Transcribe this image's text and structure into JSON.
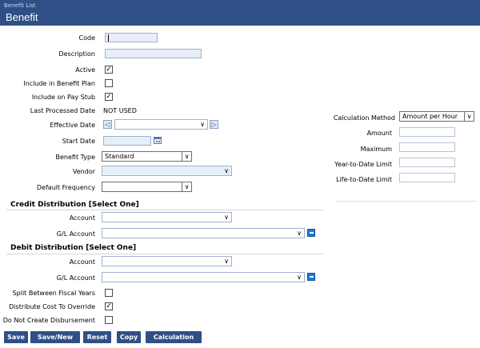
{
  "header": {
    "crumb": "Benefit List",
    "title": "Benefit"
  },
  "fields": {
    "code": "Code",
    "description": "Description",
    "active": "Active",
    "include_in_benefit_plan": "Include in Benefit Plan",
    "include_on_pay_stub": "Include on Pay Stub",
    "last_processed_date": "Last Processed Date",
    "last_processed_value": "NOT USED",
    "effective_date": "Effective Date",
    "start_date": "Start Date",
    "benefit_type": "Benefit Type",
    "benefit_type_value": "Standard",
    "vendor": "Vendor",
    "default_frequency": "Default Frequency"
  },
  "credit": {
    "title": "Credit Distribution [Select One]",
    "account": "Account",
    "gl_account": "G/L Account"
  },
  "debit": {
    "title": "Debit Distribution [Select One]",
    "account": "Account",
    "gl_account": "G/L Account"
  },
  "options": {
    "split_between_fiscal_years": "Split Between Fiscal Years",
    "distribute_cost_to_override": "Distribute Cost To Override",
    "do_not_create_disbursement": "Do Not Create Disbursement"
  },
  "calc": {
    "method_label": "Calculation Method",
    "method_value": "Amount per Hour",
    "amount": "Amount",
    "maximum": "Maximum",
    "year_to_date_limit": "Year-to-Date Limit",
    "life_to_date_limit": "Life-to-Date Limit"
  },
  "buttons": {
    "save": "Save",
    "save_new": "Save/New",
    "reset": "Reset",
    "copy": "Copy",
    "calculation": "Calculation"
  },
  "checks": {
    "active": true,
    "include_in_benefit_plan": false,
    "include_on_pay_stub": true,
    "split_between_fiscal_years": false,
    "distribute_cost_to_override": true,
    "do_not_create_disbursement": false
  },
  "icons": {
    "checkmark": "✓",
    "chevron_down": "∨",
    "prev": "◁",
    "next": "▷"
  },
  "colors": {
    "header": "#2f5086",
    "field_fill": "#e6eef9",
    "lookup": "#1e7ad6"
  }
}
